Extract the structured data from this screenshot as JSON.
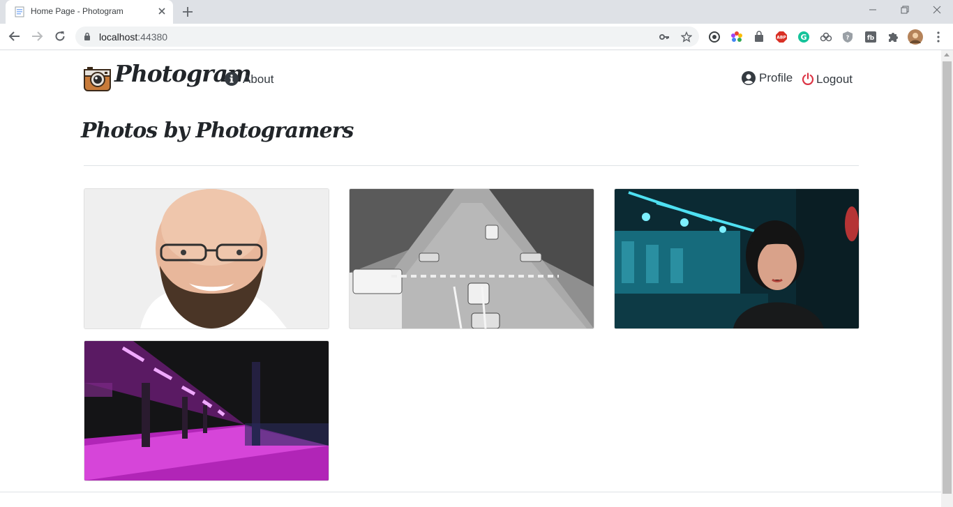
{
  "browser": {
    "tab_title": "Home Page - Photogram",
    "url_host": "localhost",
    "url_port": ":44380"
  },
  "navbar": {
    "brand": "Photogram",
    "about_label": "About",
    "profile_label": "Profile",
    "logout_label": "Logout"
  },
  "main": {
    "heading": "Photos by Photogramers",
    "photos": [
      {
        "subject": "bald-bearded-man-portrait"
      },
      {
        "subject": "black-white-city-street"
      },
      {
        "subject": "woman-in-neon-subway"
      },
      {
        "subject": "purple-neon-train-platform"
      }
    ]
  },
  "colors": {
    "accent_logout": "#dc3545",
    "text": "#343a40"
  }
}
